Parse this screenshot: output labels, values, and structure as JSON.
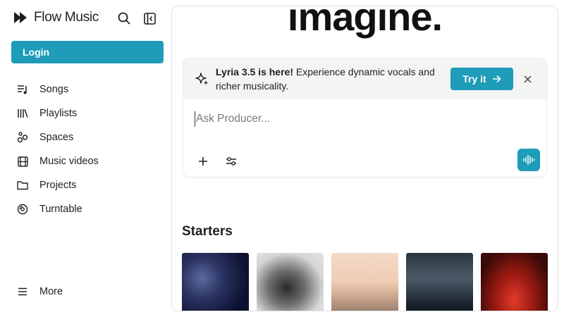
{
  "app": {
    "name": "Flow Music",
    "login_label": "Login"
  },
  "nav": {
    "items": [
      {
        "label": "Songs",
        "icon": "songs-icon"
      },
      {
        "label": "Playlists",
        "icon": "playlists-icon"
      },
      {
        "label": "Spaces",
        "icon": "spaces-icon"
      },
      {
        "label": "Music videos",
        "icon": "film-icon"
      },
      {
        "label": "Projects",
        "icon": "folder-icon"
      },
      {
        "label": "Turntable",
        "icon": "turntable-icon"
      }
    ],
    "more_label": "More"
  },
  "main": {
    "headline": "imagine.",
    "banner": {
      "bold": "Lyria 3.5 is here!",
      "text": " Experience dynamic vocals and richer musicality.",
      "try_label": "Try it"
    },
    "prompt": {
      "placeholder": "Ask Producer...",
      "value": ""
    },
    "starters_title": "Starters"
  },
  "colors": {
    "accent": "#1e9cb8",
    "text": "#1f1f1f",
    "banner_bg": "#f3f4f4"
  }
}
